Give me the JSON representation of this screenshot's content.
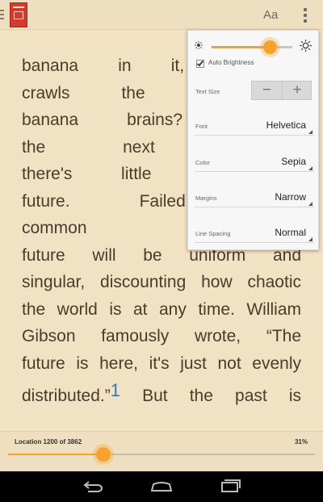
{
  "topbar": {
    "menu_icon": "hamburger-icon",
    "book_icon": "book-cover-thumbnail",
    "text_settings_label": "Aa",
    "overflow_icon": "overflow-menu-icon"
  },
  "reading": {
    "lines": [
      "banana in it, a fruit",
      "crawls the earth fo",
      "banana brains? If w",
      "the next sentence",
      "there's little hope of",
      "future. Failed predic",
      "common presumptio",
      "future will be uniform and",
      "singular, discounting how chaotic",
      "the world is at any time. William",
      "Gibson famously wrote, “The",
      "future is here, it's just not evenly"
    ],
    "last_line_before": "distributed.”",
    "footnote": "1",
    "last_line_after": " But the past is"
  },
  "settings": {
    "brightness": 0.72,
    "auto_brightness_label": "Auto Brightness",
    "auto_brightness_checked": true,
    "text_size_label": "Text Size",
    "text_size_minus": "−",
    "text_size_plus": "+",
    "font_label": "Font",
    "font_value": "Helvetica",
    "color_label": "Color",
    "color_value": "Sepia",
    "margins_label": "Margins",
    "margins_value": "Narrow",
    "line_spacing_label": "Line Spacing",
    "line_spacing_value": "Normal"
  },
  "footer": {
    "location": "Location 1200 of 3862",
    "percent": "31%",
    "progress": 0.31
  },
  "navbar": {
    "back_icon": "back-icon",
    "home_icon": "home-icon",
    "recents_icon": "recents-icon"
  },
  "colors": {
    "background": "#f2e2c4",
    "accent": "#f6a32d",
    "text": "#4a3b2c",
    "footnote": "#3a6ed0"
  }
}
